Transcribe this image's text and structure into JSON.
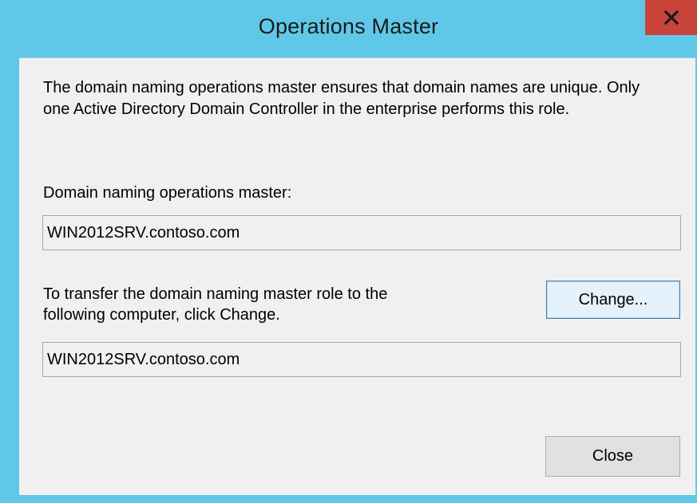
{
  "window": {
    "title": "Operations Master",
    "close_glyph": "x"
  },
  "dialog": {
    "description": "The domain naming operations master ensures that domain names are unique. Only one Active Directory Domain Controller in the enterprise performs this role.",
    "current_master_label": "Domain naming operations master:",
    "current_master_value": "WIN2012SRV.contoso.com",
    "transfer_label_line1": "To transfer the domain naming master role to the",
    "transfer_label_line2": "following computer, click Change.",
    "target_computer_value": "WIN2012SRV.contoso.com",
    "change_button_label": "Change...",
    "close_button_label": "Close"
  },
  "colors": {
    "frame": "#5fc8e8",
    "close_button": "#c8443a",
    "client_background": "#f0f0f0"
  },
  "icons": {
    "title_close": "close-icon"
  }
}
